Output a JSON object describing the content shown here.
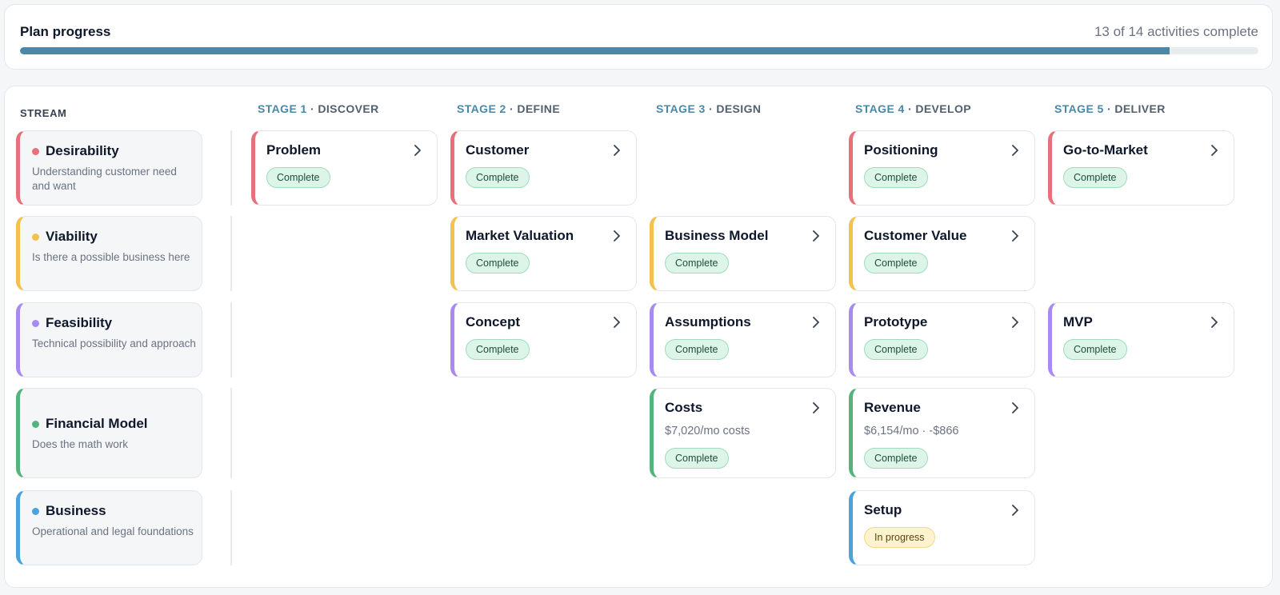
{
  "progress": {
    "title": "Plan progress",
    "count_label": "13 of 14 activities complete",
    "completed": 13,
    "total": 14,
    "bar_color": "#4a88a8"
  },
  "board": {
    "stream_header": "STREAM",
    "stages": [
      {
        "number": "STAGE 1",
        "name": " · DISCOVER"
      },
      {
        "number": "STAGE 2",
        "name": " · DEFINE"
      },
      {
        "number": "STAGE 3",
        "name": " · DESIGN"
      },
      {
        "number": "STAGE 4",
        "name": " · DEVELOP"
      },
      {
        "number": "STAGE 5",
        "name": " · DELIVER"
      }
    ],
    "streams": [
      {
        "name": "Desirability",
        "description": "Understanding customer need and want",
        "color": "#e8707a"
      },
      {
        "name": "Viability",
        "description": "Is there a possible business here",
        "color": "#f2c14e"
      },
      {
        "name": "Feasibility",
        "description": "Technical possibility and approach",
        "color": "#a78bf0"
      },
      {
        "name": "Financial Model",
        "description": "Does the math work",
        "color": "#55b37d"
      },
      {
        "name": "Business",
        "description": "Operational and legal foundations",
        "color": "#4aa3df"
      }
    ],
    "activities": {
      "problem": {
        "title": "Problem",
        "status": "Complete"
      },
      "customer": {
        "title": "Customer",
        "status": "Complete"
      },
      "positioning": {
        "title": "Positioning",
        "status": "Complete"
      },
      "go_to_market": {
        "title": "Go-to-Market",
        "status": "Complete"
      },
      "market_valuation": {
        "title": "Market Valuation",
        "status": "Complete"
      },
      "business_model": {
        "title": "Business Model",
        "status": "Complete"
      },
      "customer_value": {
        "title": "Customer Value",
        "status": "Complete"
      },
      "concept": {
        "title": "Concept",
        "status": "Complete"
      },
      "assumptions": {
        "title": "Assumptions",
        "status": "Complete"
      },
      "prototype": {
        "title": "Prototype",
        "status": "Complete"
      },
      "mvp": {
        "title": "MVP",
        "status": "Complete"
      },
      "costs": {
        "title": "Costs",
        "meta": "$7,020/mo costs",
        "status": "Complete"
      },
      "revenue": {
        "title": "Revenue",
        "meta": "$6,154/mo · -$866",
        "status": "Complete"
      },
      "setup": {
        "title": "Setup",
        "status": "In progress"
      }
    }
  }
}
